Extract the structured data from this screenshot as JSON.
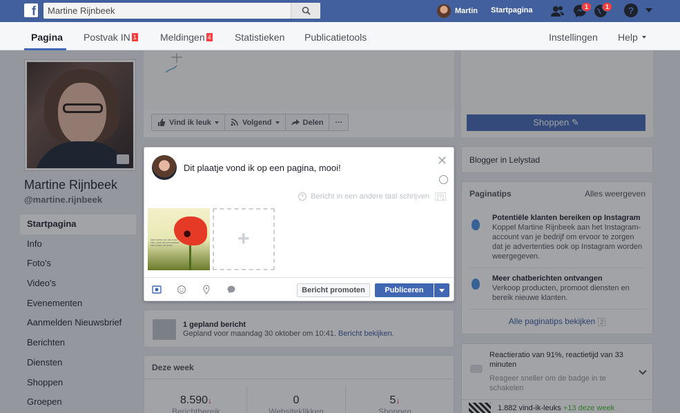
{
  "topbar": {
    "search_value": "Martine Rijnbeek",
    "user_name": "Martin",
    "home_label": "Startpagina",
    "messages_badge": "1",
    "notifications_badge": "1"
  },
  "pagenav": {
    "items": [
      {
        "label": "Pagina"
      },
      {
        "label": "Postvak IN",
        "badge": "1"
      },
      {
        "label": "Meldingen",
        "badge": "4"
      },
      {
        "label": "Statistieken"
      },
      {
        "label": "Publicatietools"
      },
      {
        "label": "Instellingen"
      },
      {
        "label": "Help"
      }
    ]
  },
  "profile": {
    "name": "Martine Rijnbeek",
    "handle": "@martine.rijnbeek"
  },
  "leftnav": {
    "items": [
      "Startpagina",
      "Info",
      "Foto's",
      "Video's",
      "Evenementen",
      "Aanmelden Nieuwsbrief",
      "Berichten",
      "Diensten",
      "Shoppen",
      "Groepen"
    ]
  },
  "actions": {
    "like": "Vind ik leuk",
    "follow": "Volgend",
    "share": "Delen",
    "more": "···",
    "shop": "Shoppen"
  },
  "composer": {
    "text": "Dit plaatje vond ik op een pagina, mooi!",
    "translate": "Bericht in een andere taal schrijven",
    "translate_help": "[?]",
    "image_caption": "Dat moeten we dan maar zien, want het ene bestaat niet zonder de ander",
    "promote": "Bericht promoten",
    "publish": "Publiceren"
  },
  "scheduled": {
    "title": "1 gepland bericht",
    "subtitle": "Gepland voor maandag 30 oktober om 10:41.",
    "link": "Bericht bekijken."
  },
  "week": {
    "title": "Deze week",
    "stats": [
      {
        "value": "8.590",
        "trend": "↓",
        "label": "Berichtbereik"
      },
      {
        "value": "0",
        "trend": "",
        "label": "Websiteklikken"
      },
      {
        "value": "5",
        "trend": "↓",
        "label": "Shoppen"
      }
    ]
  },
  "right": {
    "blogger": "Blogger in Lelystad",
    "tips": {
      "title": "Paginatips",
      "see_all": "Alles weergeven",
      "items": [
        {
          "head": "Potentiële klanten bereiken op Instagram",
          "body": "Koppel Martine Rijnbeek aan het Instagram-account van je bedrijf om ervoor te zorgen dat je advertenties ook op Instagram worden weergegeven."
        },
        {
          "head": "Meer chatberichten ontvangen",
          "body": "Verkoop producten, promoot diensten en bereik nieuwe klanten."
        }
      ],
      "footer": "Alle paginatips bekijken",
      "footer_count": "2"
    },
    "response": {
      "head": "Reactieratio van 91%, reactietijd van 33 minuten",
      "sub": "Reageer sneller om de badge in te schakelen"
    },
    "likes": {
      "text": "1.882 vind-ik-leuks",
      "plus": "+13 deze week"
    }
  },
  "colors": {
    "brand_blue": "#4267b2",
    "topbar_blue": "#42609e",
    "badge_red": "#fa3e3e"
  }
}
